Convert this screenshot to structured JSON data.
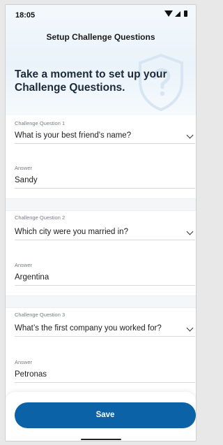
{
  "status_bar": {
    "time": "18:05"
  },
  "app_bar": {
    "title": "Setup Challenge Questions"
  },
  "intro": {
    "headline": "Take a moment to set up your Challenge Questions."
  },
  "questions": [
    {
      "label": "Challenge Question 1",
      "question": "What is your best friend's name?",
      "answer_label": "Answer",
      "answer": "Sandy"
    },
    {
      "label": "Challenge Question 2",
      "question": "Which city were you married in?",
      "answer_label": "Answer",
      "answer": "Argentina"
    },
    {
      "label": "Challenge Question 3",
      "question": "What’s the first company you worked for?",
      "answer_label": "Answer",
      "answer": "Petronas"
    }
  ],
  "footer": {
    "save_label": "Save"
  },
  "colors": {
    "accent": "#0b62a6"
  },
  "icons": {
    "wifi": "wifi-icon",
    "signal": "cell-signal-icon",
    "battery": "battery-icon",
    "shield": "shield-question-icon",
    "chevron": "chevron-down-icon"
  }
}
